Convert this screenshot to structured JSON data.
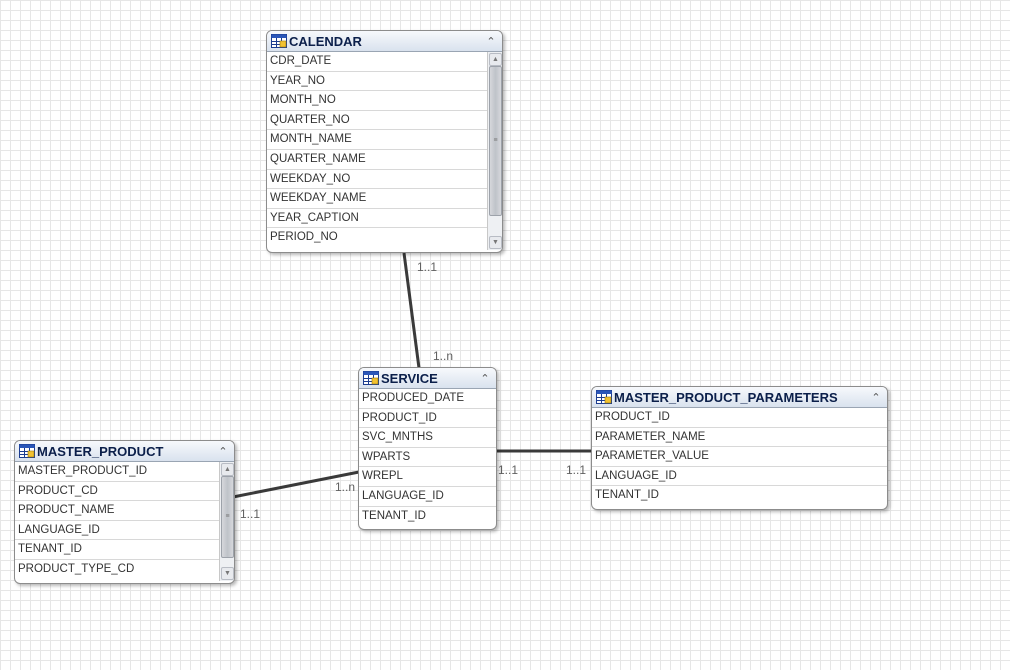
{
  "entities": {
    "calendar": {
      "name": "CALENDAR",
      "columns": [
        "CDR_DATE",
        "YEAR_NO",
        "MONTH_NO",
        "QUARTER_NO",
        "MONTH_NAME",
        "QUARTER_NAME",
        "WEEKDAY_NO",
        "WEEKDAY_NAME",
        "YEAR_CAPTION",
        "PERIOD_NO"
      ],
      "has_scrollbar": true
    },
    "service": {
      "name": "SERVICE",
      "columns": [
        "PRODUCED_DATE",
        "PRODUCT_ID",
        "SVC_MNTHS",
        "WPARTS",
        "WREPL",
        "LANGUAGE_ID",
        "TENANT_ID"
      ],
      "has_scrollbar": false
    },
    "master_product": {
      "name": "MASTER_PRODUCT",
      "columns": [
        "MASTER_PRODUCT_ID",
        "PRODUCT_CD",
        "PRODUCT_NAME",
        "LANGUAGE_ID",
        "TENANT_ID",
        "PRODUCT_TYPE_CD"
      ],
      "has_scrollbar": true
    },
    "master_product_parameters": {
      "name": "MASTER_PRODUCT_PARAMETERS",
      "columns": [
        "PRODUCT_ID",
        "PARAMETER_NAME",
        "PARAMETER_VALUE",
        "LANGUAGE_ID",
        "TENANT_ID"
      ],
      "has_scrollbar": false
    }
  },
  "relationships": [
    {
      "from": "calendar",
      "to": "service",
      "from_multiplicity": "1..1",
      "to_multiplicity": "1..n"
    },
    {
      "from": "master_product",
      "to": "service",
      "from_multiplicity": "1..1",
      "to_multiplicity": "1..n"
    },
    {
      "from": "service",
      "to": "master_product_parameters",
      "from_multiplicity": "1..1",
      "to_multiplicity": "1..1"
    }
  ],
  "colors": {
    "title_text": "#0b1f4a",
    "header_gradient_top": "#f7f9fc",
    "header_gradient_bottom": "#d9e2ee",
    "connector": "#3a3a3a",
    "grid": "#e6e6e6"
  },
  "icons": {
    "entity": "table-icon",
    "collapse": "double-chevron-up-icon"
  }
}
